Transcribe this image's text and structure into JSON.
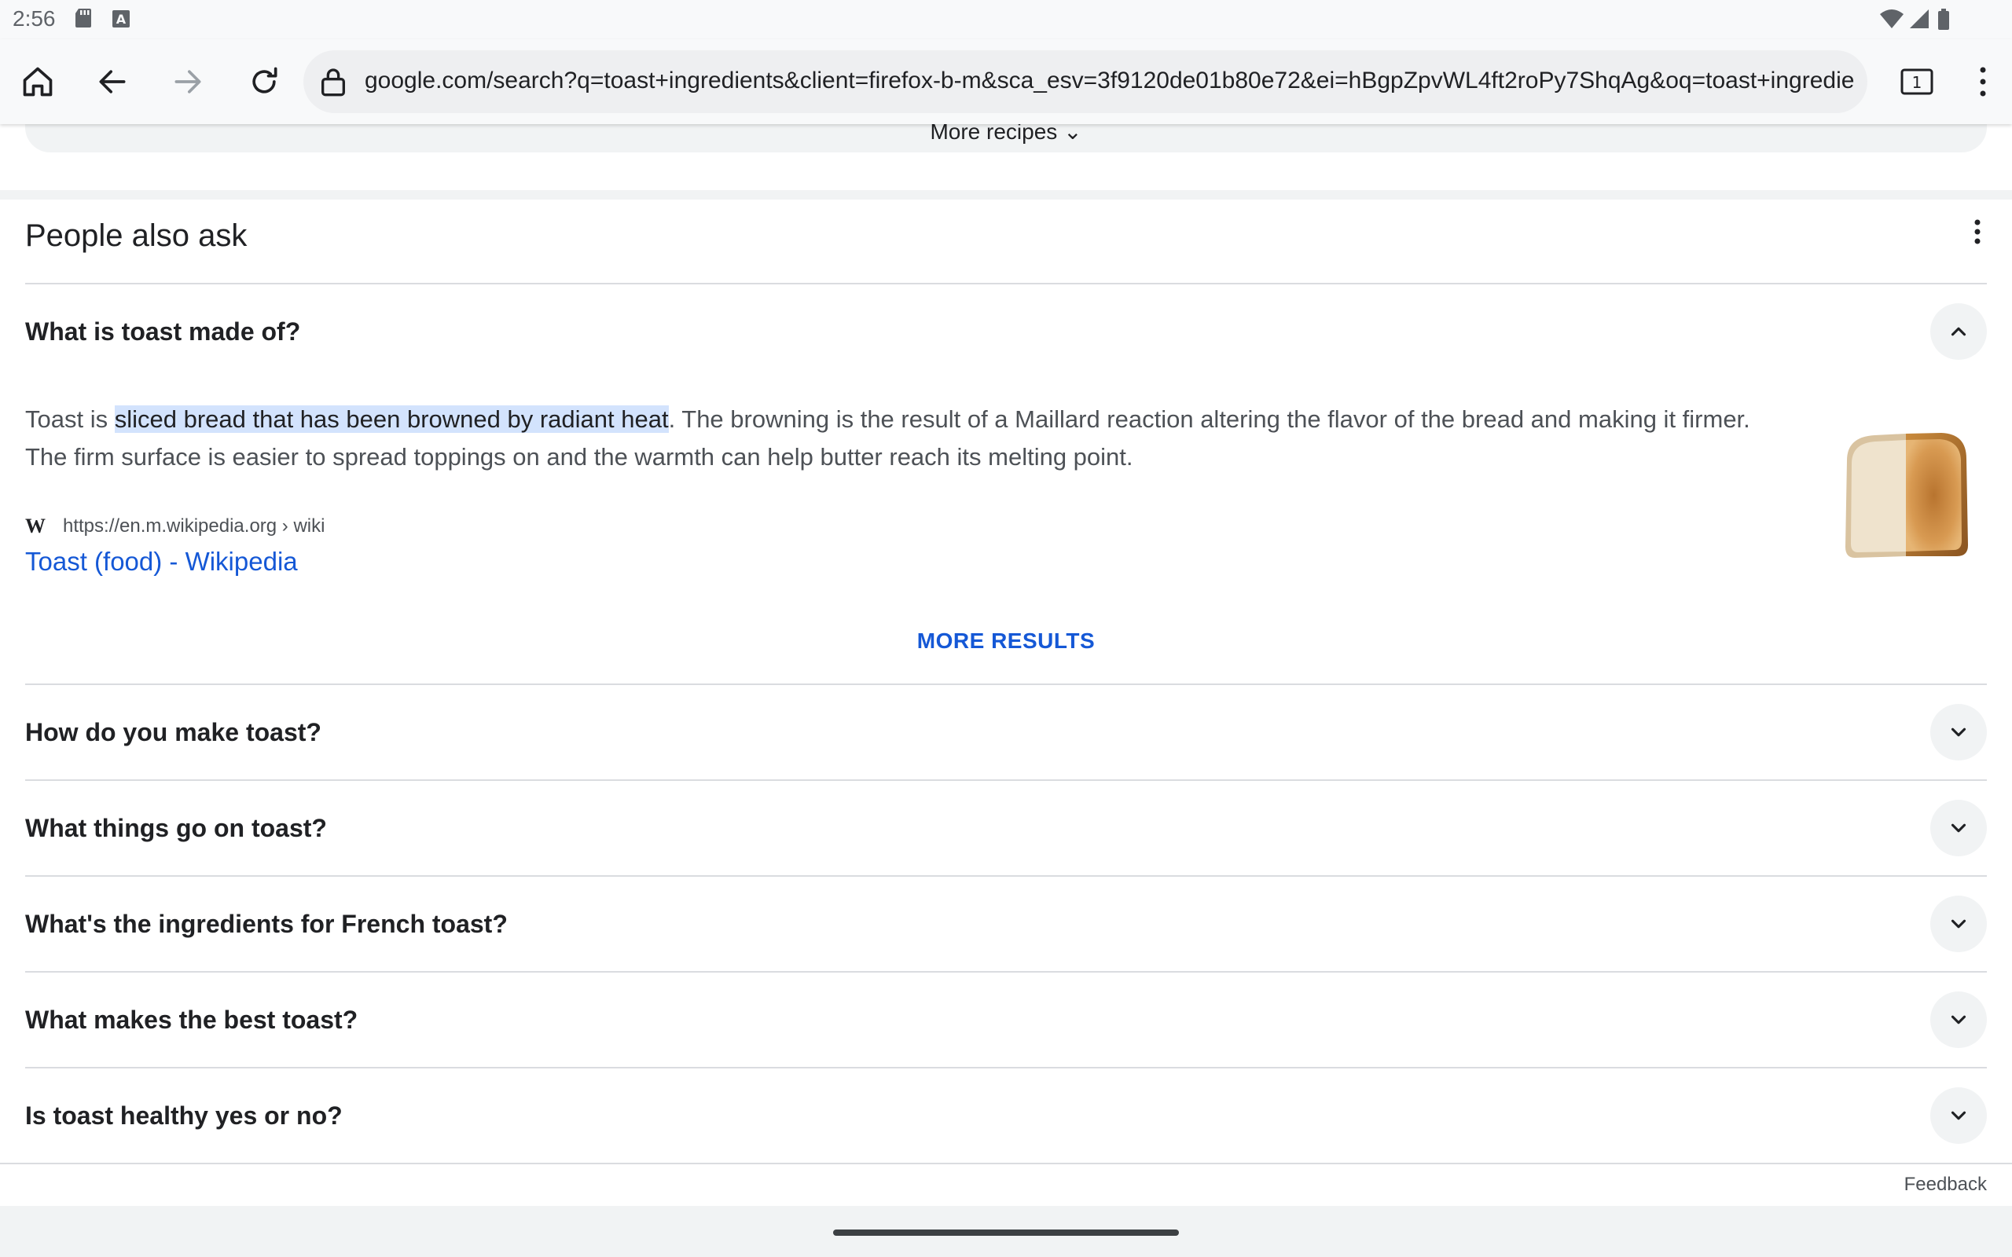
{
  "status_bar": {
    "time": "2:56"
  },
  "browser": {
    "url": "google.com/search?q=toast+ingredients&client=firefox-b-m&sca_esv=3f9120de01b80e72&ei=hBgpZpvWL4ft2roPy7ShqAg&oq=toast+ingredients",
    "tab_count": "1"
  },
  "more_recipes": {
    "label": "More recipes"
  },
  "people_also_ask": {
    "title": "People also ask",
    "expanded": {
      "question": "What is toast made of?",
      "answer_before": "Toast is ",
      "answer_highlight": "sliced bread that has been browned by radiant heat",
      "answer_after": ". The browning is the result of a Maillard reaction altering the flavor of the bread and making it firmer. The firm surface is easier to spread toppings on and the warmth can help butter reach its melting point.",
      "source_url": "https://en.m.wikipedia.org › wiki",
      "source_title": "Toast (food) - Wikipedia",
      "more_results": "MORE RESULTS"
    },
    "questions": [
      {
        "label": "How do you make toast?"
      },
      {
        "label": "What things go on toast?"
      },
      {
        "label": "What's the ingredients for French toast?"
      },
      {
        "label": "What makes the best toast?"
      },
      {
        "label": "Is toast healthy yes or no?"
      }
    ]
  },
  "footer": {
    "feedback": "Feedback"
  },
  "icons": [
    "sd-card-icon",
    "keyboard-a-icon",
    "wifi-icon",
    "signal-icon",
    "battery-icon",
    "home-icon",
    "back-icon",
    "forward-icon",
    "reload-icon",
    "lock-icon",
    "tabs-icon",
    "menu-icon",
    "kebab-icon",
    "chevron-up-icon",
    "chevron-down-icon",
    "wikipedia-icon"
  ],
  "colors": {
    "accent": "#1558d6",
    "highlight": "#d3e3fd",
    "text": "#202124",
    "muted": "#4d5156"
  }
}
